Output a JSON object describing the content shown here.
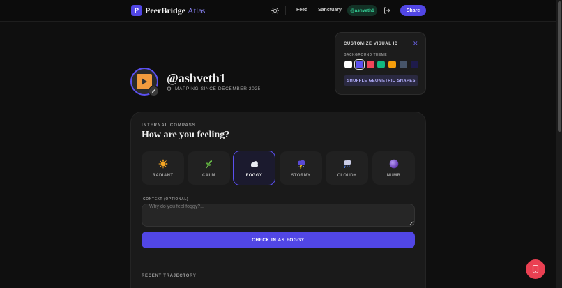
{
  "header": {
    "logo_letter": "P",
    "brand_main": "PeerBridge",
    "brand_accent": "Atlas",
    "theme_icon": "sun-icon",
    "nav": {
      "feed": "Feed",
      "sanctuary": "Sanctuary"
    },
    "user_pill": "@ashveth1",
    "logout_icon": "logout-icon",
    "share_label": "Share"
  },
  "profile": {
    "handle": "@ashveth1",
    "since": "MAPPING SINCE DECEMBER 2025",
    "location_icon": "pin-icon",
    "edit_icon": "pencil-icon"
  },
  "customize": {
    "title": "CUSTOMIZE VISUAL ID",
    "close_icon": "close-icon",
    "background_theme_label": "BACKGROUND THEME",
    "swatches": [
      "#ffffff",
      "#5b50f0",
      "#f0465a",
      "#10b981",
      "#f59e0b",
      "#475569",
      "#1e1b4b"
    ],
    "selected_swatch": "#5b50f0",
    "shuffle_label": "SHUFFLE GEOMETRIC SHAPES"
  },
  "compass": {
    "eyebrow": "INTERNAL COMPASS",
    "question": "How are you feeling?",
    "moods": [
      {
        "label": "RADIANT",
        "icon": "sun-icon"
      },
      {
        "label": "CALM",
        "icon": "herb-icon"
      },
      {
        "label": "FOGGY",
        "icon": "cloud-icon"
      },
      {
        "label": "STORMY",
        "icon": "thunderstorm-icon"
      },
      {
        "label": "CLOUDY",
        "icon": "rain-cloud-icon"
      },
      {
        "label": "NUMB",
        "icon": "purple-circle-icon"
      }
    ],
    "selected_mood": "FOGGY",
    "context_label": "CONTEXT (OPTIONAL)",
    "context_placeholder": "Why do you feel foggy?...",
    "context_value": "",
    "checkin_label": "CHECK IN AS FOGGY"
  },
  "trajectory_label": "RECENT TRAJECTORY",
  "fab_icon": "phone-icon",
  "colors": {
    "accent": "#5146e5",
    "fab": "#ea4052",
    "user_green": "#34d399"
  }
}
